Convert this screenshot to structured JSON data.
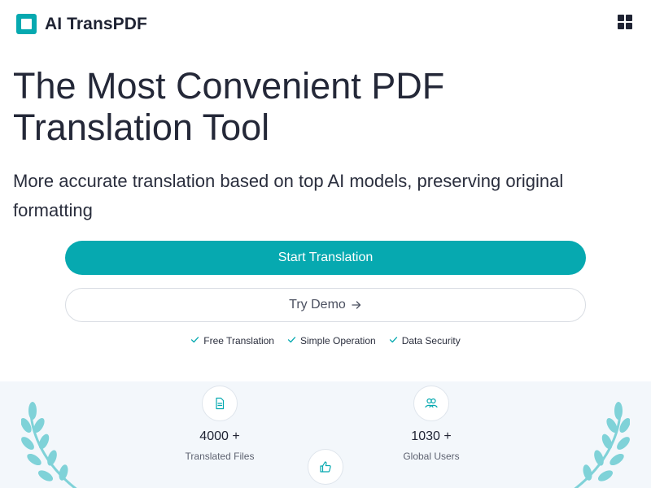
{
  "header": {
    "brand_name": "AI TransPDF",
    "logo_icon": "logo-icon",
    "menu_icon": "grid-menu-icon"
  },
  "hero": {
    "title_line1": "The Most Convenient PDF",
    "title_line2": "Translation Tool",
    "subtitle": "More accurate translation based on top AI models, preserving original formatting"
  },
  "actions": {
    "primary_label": "Start Translation",
    "secondary_label": "Try Demo",
    "secondary_icon": "arrow-right-icon"
  },
  "features": [
    {
      "label": "Free Translation",
      "icon": "check-icon"
    },
    {
      "label": "Simple Operation",
      "icon": "check-icon"
    },
    {
      "label": "Data Security",
      "icon": "check-icon"
    }
  ],
  "stats": [
    {
      "value": "4000 +",
      "label": "Translated Files",
      "icon": "document-icon"
    },
    {
      "value": "1030 +",
      "label": "Global Users",
      "icon": "users-icon"
    },
    {
      "icon": "thumbs-up-icon"
    }
  ],
  "colors": {
    "accent": "#06a9b0",
    "text": "#1f2333",
    "stats_bg": "#f3f7fb",
    "laurel": "#7fd2d8"
  }
}
